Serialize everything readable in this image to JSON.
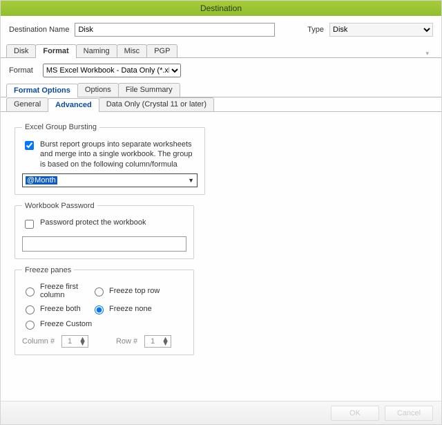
{
  "window_title": "Destination",
  "header": {
    "name_label": "Destination Name",
    "name_value": "Disk",
    "type_label": "Type",
    "type_value": "Disk"
  },
  "main_tabs": [
    "Disk",
    "Format",
    "Naming",
    "Misc",
    "PGP"
  ],
  "main_tab_active": 1,
  "format_row": {
    "label": "Format",
    "value": "MS Excel Workbook - Data Only (*.xlsx)"
  },
  "sec_tabs": [
    "Format Options",
    "Options",
    "File Summary"
  ],
  "sec_tab_active": 0,
  "sub_tabs": [
    "General",
    "Advanced",
    "Data Only (Crystal 11 or later)"
  ],
  "sub_tab_active": 1,
  "bursting": {
    "legend": "Excel Group Bursting",
    "checkbox": true,
    "desc": "Burst report groups into separate worksheets and merge into a single workbook. The group is based on the following column/formula",
    "value": "@Month"
  },
  "password": {
    "legend": "Workbook Password",
    "checkbox": false,
    "label": "Password protect the workbook",
    "value": ""
  },
  "freeze": {
    "legend": "Freeze panes",
    "radios": [
      "Freeze first column",
      "Freeze top row",
      "Freeze both",
      "Freeze none",
      "Freeze Custom"
    ],
    "selected": "Freeze none",
    "col_label": "Column #",
    "col_val": "1",
    "row_label": "Row #",
    "row_val": "1"
  },
  "buttons": {
    "ok": "OK",
    "cancel": "Cancel"
  }
}
